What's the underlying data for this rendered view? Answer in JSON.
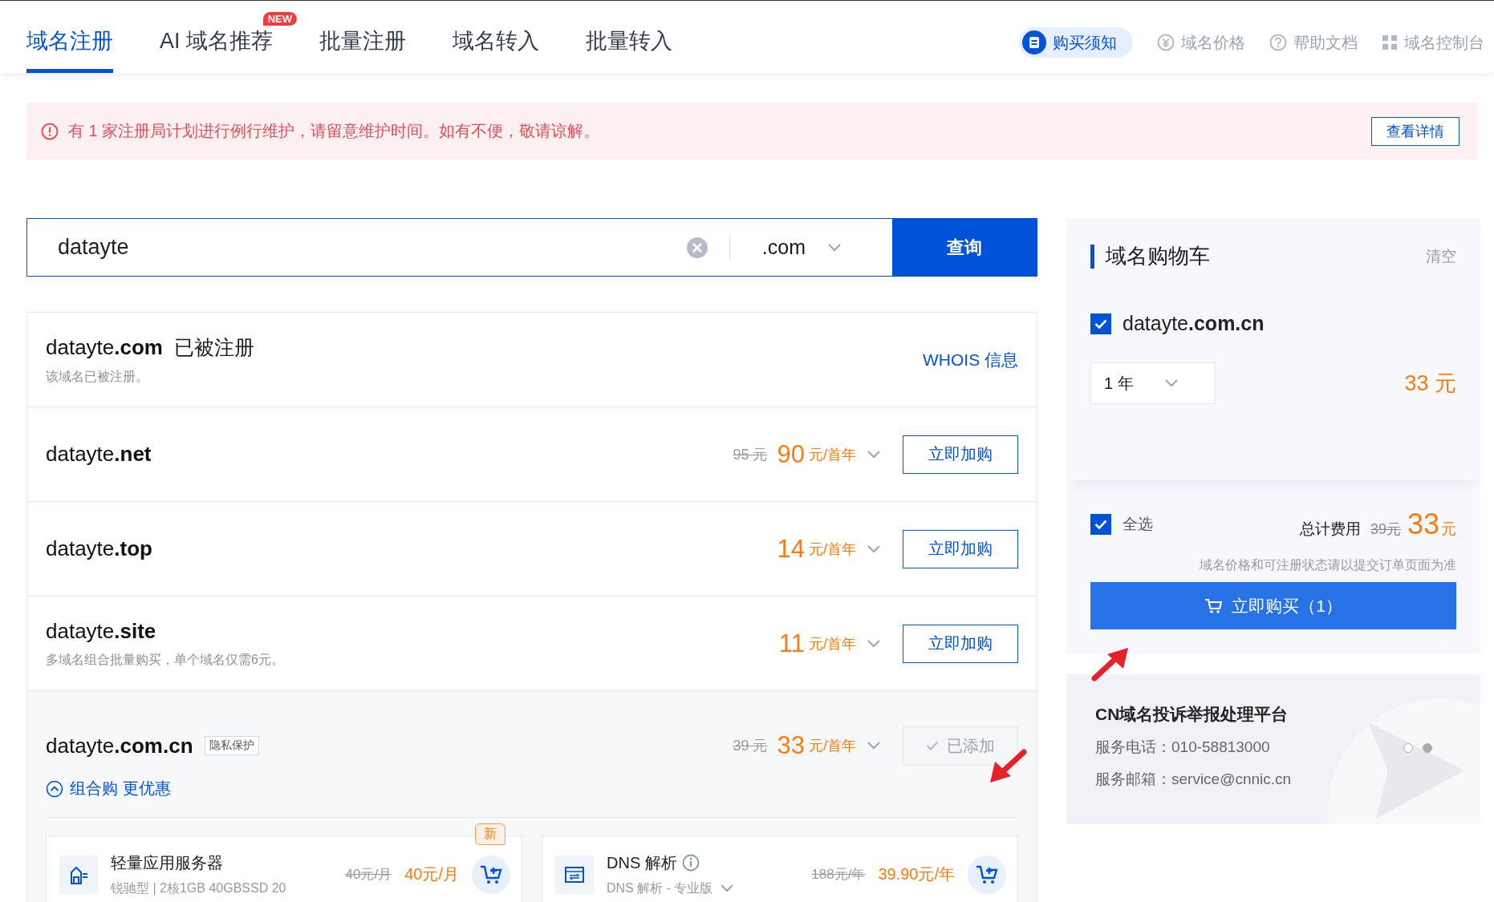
{
  "nav": {
    "tabs": [
      {
        "label": "域名注册",
        "selected": true
      },
      {
        "label": "AI 域名推荐",
        "selected": false,
        "badge": "NEW"
      },
      {
        "label": "批量注册",
        "selected": false
      },
      {
        "label": "域名转入",
        "selected": false
      },
      {
        "label": "批量转入",
        "selected": false
      }
    ],
    "links": [
      {
        "label": "购买须知",
        "selected": true
      },
      {
        "label": "域名价格",
        "selected": false
      },
      {
        "label": "帮助文档",
        "selected": false
      },
      {
        "label": "域名控制台",
        "selected": false
      }
    ]
  },
  "notice": {
    "text": "有 1 家注册局计划进行例行维护，请留意维护时间。如有不便，敬请谅解。",
    "button": "查看详情"
  },
  "search": {
    "value": "datayte",
    "suffix": ".com",
    "button": "查询"
  },
  "results": [
    {
      "kind": "registered",
      "name": "datayte",
      "tld": ".com",
      "status": "已被注册",
      "note": "该域名已被注册。",
      "link": "WHOIS 信息"
    },
    {
      "kind": "available",
      "name": "datayte",
      "tld": ".net",
      "old_price": "95 元",
      "price": "90",
      "unit": "元/首年",
      "button": "立即加购"
    },
    {
      "kind": "available",
      "name": "datayte",
      "tld": ".top",
      "price": "14",
      "unit": "元/首年",
      "button": "立即加购"
    },
    {
      "kind": "available",
      "name": "datayte",
      "tld": ".site",
      "note": "多域名组合批量购买，单个域名仅需6元。",
      "price": "11",
      "unit": "元/首年",
      "button": "立即加购"
    },
    {
      "kind": "added",
      "name": "datayte",
      "tld": ".com.cn",
      "tag": "隐私保护",
      "old_price": "39 元",
      "price": "33",
      "unit": "元/首年",
      "button": "已添加",
      "combo": {
        "label": "组合购 更优惠",
        "expanded": true
      },
      "bundles": [
        {
          "title": "轻量应用服务器",
          "info_icon": false,
          "subtitle": "锐驰型 | 2核1GB 40GBSSD 20",
          "has_dropdown": false,
          "old_price": "40元/月",
          "price": "40元/月",
          "badge": "新"
        },
        {
          "title": "DNS 解析",
          "info_icon": true,
          "subtitle": "DNS 解析 - 专业版",
          "has_dropdown": true,
          "old_price": "188元/年",
          "price": "39.90元/年"
        }
      ]
    }
  ],
  "cart": {
    "title": "域名购物车",
    "clear": "清空",
    "items": [
      {
        "name": "datayte",
        "tld": ".com.cn",
        "checked": true,
        "period": "1 年",
        "price": "33 元"
      }
    ],
    "select_all": {
      "label": "全选",
      "checked": true
    },
    "total_label": "总计费用",
    "total_old": "39元",
    "total_price": "33",
    "total_unit": "元",
    "disclaimer": "域名价格和可注册状态请以提交订单页面为准",
    "buy_button": "立即购买（1）"
  },
  "info_panel": {
    "title": "CN域名投诉举报处理平台",
    "lines": [
      "服务电话：010-58813000",
      "服务邮箱：service@cnnic.cn"
    ],
    "dots": [
      {
        "selected": false
      },
      {
        "selected": true
      }
    ]
  }
}
